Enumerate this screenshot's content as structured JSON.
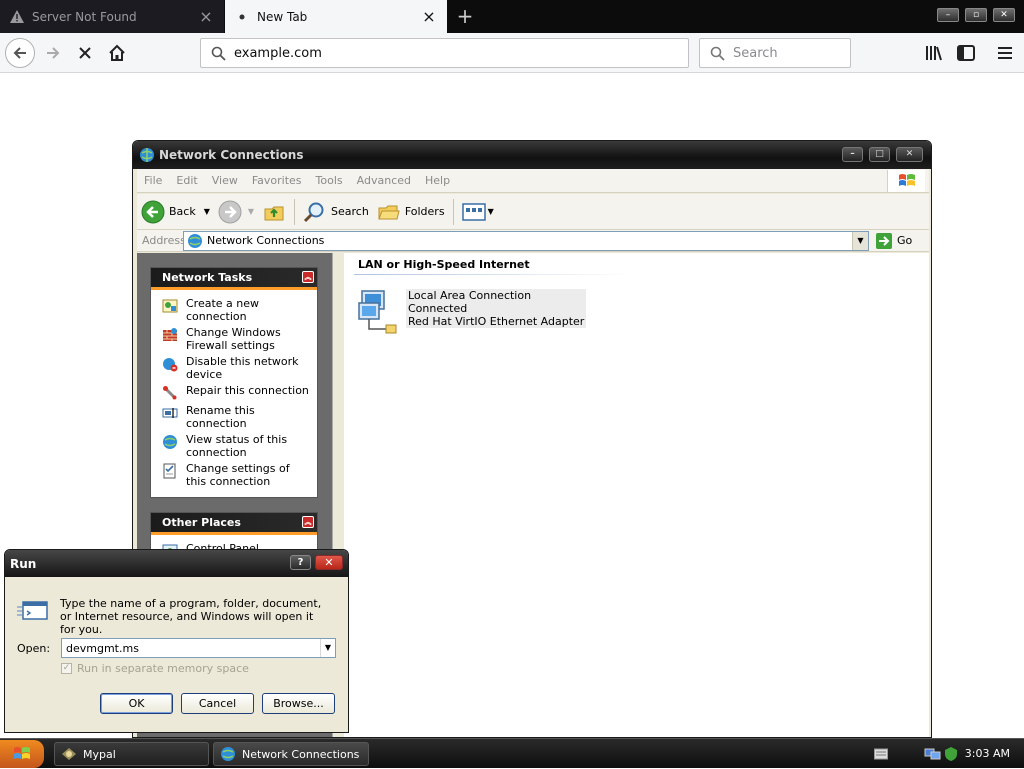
{
  "browser": {
    "tabs": [
      {
        "title": "Server Not Found",
        "active": false
      },
      {
        "title": "New Tab",
        "active": true
      }
    ],
    "url": "example.com",
    "search_placeholder": "Search"
  },
  "net_window": {
    "title": "Network Connections",
    "menu": [
      "File",
      "Edit",
      "View",
      "Favorites",
      "Tools",
      "Advanced",
      "Help"
    ],
    "toolbar": {
      "back": "Back",
      "search": "Search",
      "folders": "Folders"
    },
    "address_label": "Address",
    "address_value": "Network Connections",
    "go_label": "Go",
    "network_tasks": {
      "title": "Network Tasks",
      "items": [
        "Create a new connection",
        "Change Windows Firewall settings",
        "Disable this network device",
        "Repair this connection",
        "Rename this connection",
        "View status of this connection",
        "Change settings of this connection"
      ]
    },
    "other_places": {
      "title": "Other Places",
      "items": [
        "Control Panel"
      ]
    },
    "group_header": "LAN or High-Speed Internet",
    "connection": {
      "name": "Local Area Connection",
      "status": "Connected",
      "adapter": "Red Hat VirtIO Ethernet Adapter"
    }
  },
  "run_dialog": {
    "title": "Run",
    "help": "?",
    "description": "Type the name of a program, folder, document, or Internet resource, and Windows will open it for you.",
    "open_label": "Open:",
    "open_value": "devmgmt.ms",
    "separate_memory": "Run in separate memory space",
    "ok": "OK",
    "cancel": "Cancel",
    "browse": "Browse..."
  },
  "taskbar": {
    "buttons": [
      "Mypal",
      "Network Connections"
    ],
    "clock": "3:03 AM"
  }
}
